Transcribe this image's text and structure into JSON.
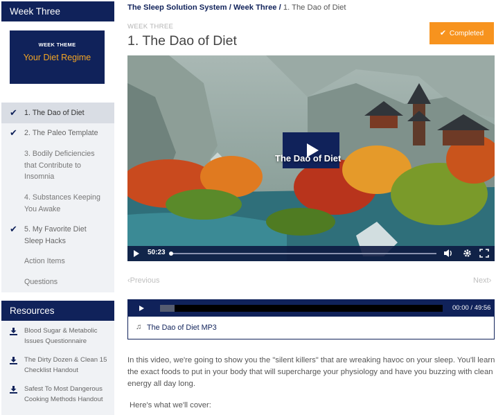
{
  "sidebar": {
    "week_heading": "Week Three",
    "theme_label": "WEEK THEME",
    "theme_title": "Your Diet Regime",
    "lessons": [
      {
        "label": "1. The Dao of Diet",
        "done": true,
        "active": true
      },
      {
        "label": "2. The Paleo Template",
        "done": true
      },
      {
        "label": "3. Bodily Deficiencies that Contribute to Insomnia",
        "done": false
      },
      {
        "label": "4. Substances Keeping You Awake",
        "done": false
      },
      {
        "label": "5. My Favorite Diet Sleep Hacks",
        "done": true
      },
      {
        "label": "Action Items",
        "done": false
      },
      {
        "label": "Questions",
        "done": false
      }
    ],
    "resources_heading": "Resources",
    "resources": [
      {
        "label": "Blood Sugar & Metabolic Issues Questionnaire"
      },
      {
        "label": "The Dirty Dozen & Clean 15 Checklist Handout"
      },
      {
        "label": "Safest To Most Dangerous Cooking Methods Handout"
      }
    ]
  },
  "breadcrumb": {
    "course": "The Sleep Solution System",
    "sep": " / ",
    "week": "Week Three",
    "current": "1. The Dao of Diet"
  },
  "lesson": {
    "week_label": "WEEK THREE",
    "title": "1. The Dao of Diet",
    "completed_label": "Completed"
  },
  "video": {
    "overlay_title": "The Dao of Diet",
    "duration": "50:23",
    "progress": 0.0
  },
  "nav": {
    "prev": "Previous",
    "next": "Next"
  },
  "audio": {
    "time": "00:00 / 49:56",
    "file_name": "The Dao of Diet MP3"
  },
  "content": {
    "description": "In this video, we're going to show you the \"silent killers\" that are wreaking havoc on your sleep. You'll learn the exact foods to put in your body that will supercharge your physiology and have you buzzing with clean energy all day long.",
    "cover_heading": "Here's what we'll cover:"
  },
  "colors": {
    "navy": "#10225a",
    "orange": "#f7931e",
    "theme_gold": "#f5a623",
    "sidebar_bg": "#f0f2f5"
  }
}
